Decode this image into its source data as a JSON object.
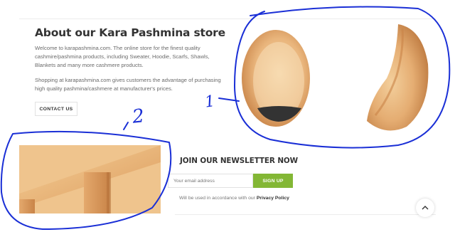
{
  "about": {
    "title": "About our Kara Pashmina store",
    "paragraph_1": "Welcome to karapashmina.com. The online store for the finest quality cashmire/pashmina products, including Sweater, Hoodie, Scarfs, Shawls, Blankets and many more cashmere products.",
    "paragraph_2": "Shopping at karapashmina.com gives customers the advantage of purchasing high quality pashmina/cashmere at manufacturer's prices.",
    "contact_button": "CONTACT US"
  },
  "newsletter": {
    "title": "JOIN OUR NEWSLETTER NOW",
    "email_placeholder": "Your email address",
    "email_value": "",
    "signup_button": "SIGN UP",
    "policy_text": "Will be used in accordance with our",
    "policy_link": "Privacy Policy"
  },
  "annotations": {
    "label_1": "1",
    "label_2": "2",
    "ink_color": "#1a2fd6"
  },
  "colors": {
    "accent": "#83b735",
    "wood_light": "#f1c58e",
    "wood_mid": "#e0a46a",
    "wood_dark": "#c98448"
  },
  "icons": {
    "scroll_top": "chevron-up-icon"
  }
}
